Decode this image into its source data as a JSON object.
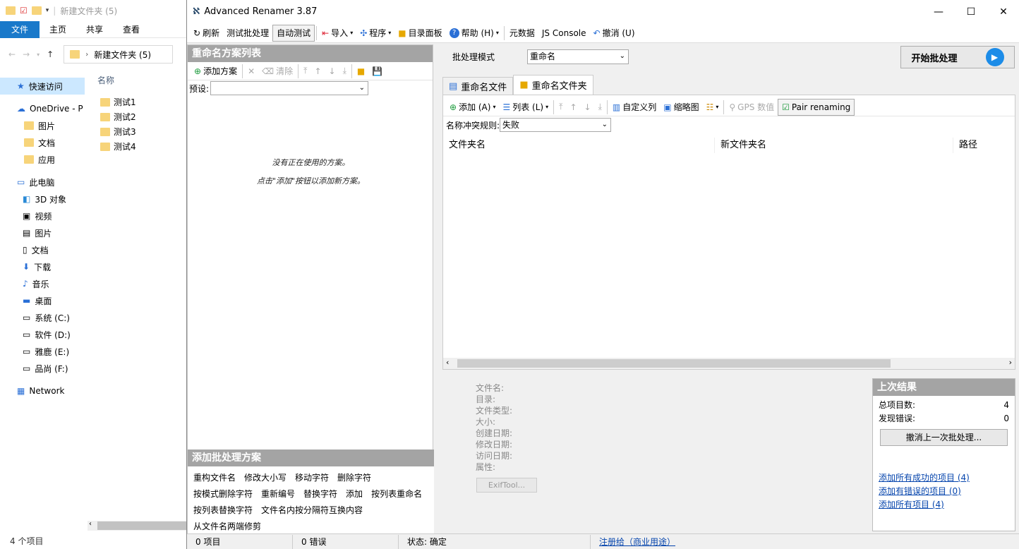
{
  "explorer": {
    "path_title": "新建文件夹 (5)",
    "ribbon_tabs": [
      "文件",
      "主页",
      "共享",
      "查看"
    ],
    "address": "新建文件夹 (5)",
    "column_name": "名称",
    "nav": [
      "快速访问",
      "OneDrive - P",
      "图片",
      "文档",
      "应用",
      "此电脑",
      "3D 对象",
      "视频",
      "图片",
      "文档",
      "下载",
      "音乐",
      "桌面",
      "系统 (C:)",
      "软件 (D:)",
      "雅鹿 (E:)",
      "品尚 (F:)",
      "Network"
    ],
    "files": [
      "测试1",
      "测试2",
      "测试3",
      "测试4"
    ],
    "status": "4 个项目"
  },
  "window": {
    "title": "Advanced Renamer 3.87",
    "min_glyph": "—",
    "max_glyph": "☐",
    "close_glyph": "✕"
  },
  "toolbar": {
    "refresh": "刷新",
    "test_batch": "测试批处理",
    "auto_test": "自动测试",
    "import": "导入",
    "program": "程序",
    "dir_panel": "目录面板",
    "help": "帮助 (H)",
    "metadata": "元数据",
    "js_console": "JS Console",
    "undo": "撤消 (U)"
  },
  "left_panel": {
    "title": "重命名方案列表",
    "add_method": "添加方案",
    "clear": "清除",
    "preset_label": "预设:",
    "preset_value": "",
    "empty_line1": "没有正在使用的方案。",
    "empty_line2": "点击\"添加\"按钮以添加新方案。"
  },
  "methods_panel": {
    "title": "添加批处理方案",
    "rows": [
      [
        "重构文件名",
        "修改大小写",
        "移动字符",
        "删除字符"
      ],
      [
        "按模式删除字符",
        "重新编号",
        "替换字符",
        "添加",
        "按列表重命名"
      ],
      [
        "按列表替换字符",
        "文件名内按分隔符互换内容"
      ],
      [
        "从文件名两端修剪"
      ]
    ]
  },
  "batch": {
    "mode_label": "批处理模式",
    "mode_value": "重命名",
    "start_button": "开始批处理"
  },
  "tabs": {
    "files": "重命名文件",
    "folders": "重命名文件夹"
  },
  "list_toolbar": {
    "add": "添加 (A)",
    "list": "列表 (L)",
    "custom_columns": "自定义列",
    "thumbnail": "缩略图",
    "gps": "GPS 数值",
    "pair_renaming": "Pair renaming",
    "conflict_label": "名称冲突规则:",
    "conflict_value": "失败"
  },
  "columns": [
    "文件夹名",
    "新文件夹名",
    "路径"
  ],
  "info": {
    "labels": [
      "文件名:",
      "目录:",
      "文件类型:",
      "大小:",
      "创建日期:",
      "修改日期:",
      "访问日期:",
      "属性:"
    ],
    "exif_button": "ExifTool..."
  },
  "results": {
    "title": "上次结果",
    "total_label": "总项目数:",
    "total_value": "4",
    "errors_label": "发现错误:",
    "errors_value": "0",
    "undo_button": "撤消上一次批处理...",
    "link_success": "添加所有成功的项目 (4)",
    "link_errors": "添加有错误的项目 (0)",
    "link_all": "添加所有项目 (4)"
  },
  "status_bar": {
    "items": "0 项目",
    "errors": "0 错误",
    "state": "状态: 确定",
    "license": "注册给（商业用途）"
  },
  "colors": {
    "panel_header": "#a4a4a4",
    "explorer_file_tab": "#1979ca",
    "link": "#0645ad",
    "start_icon": "#1c8ce8"
  }
}
